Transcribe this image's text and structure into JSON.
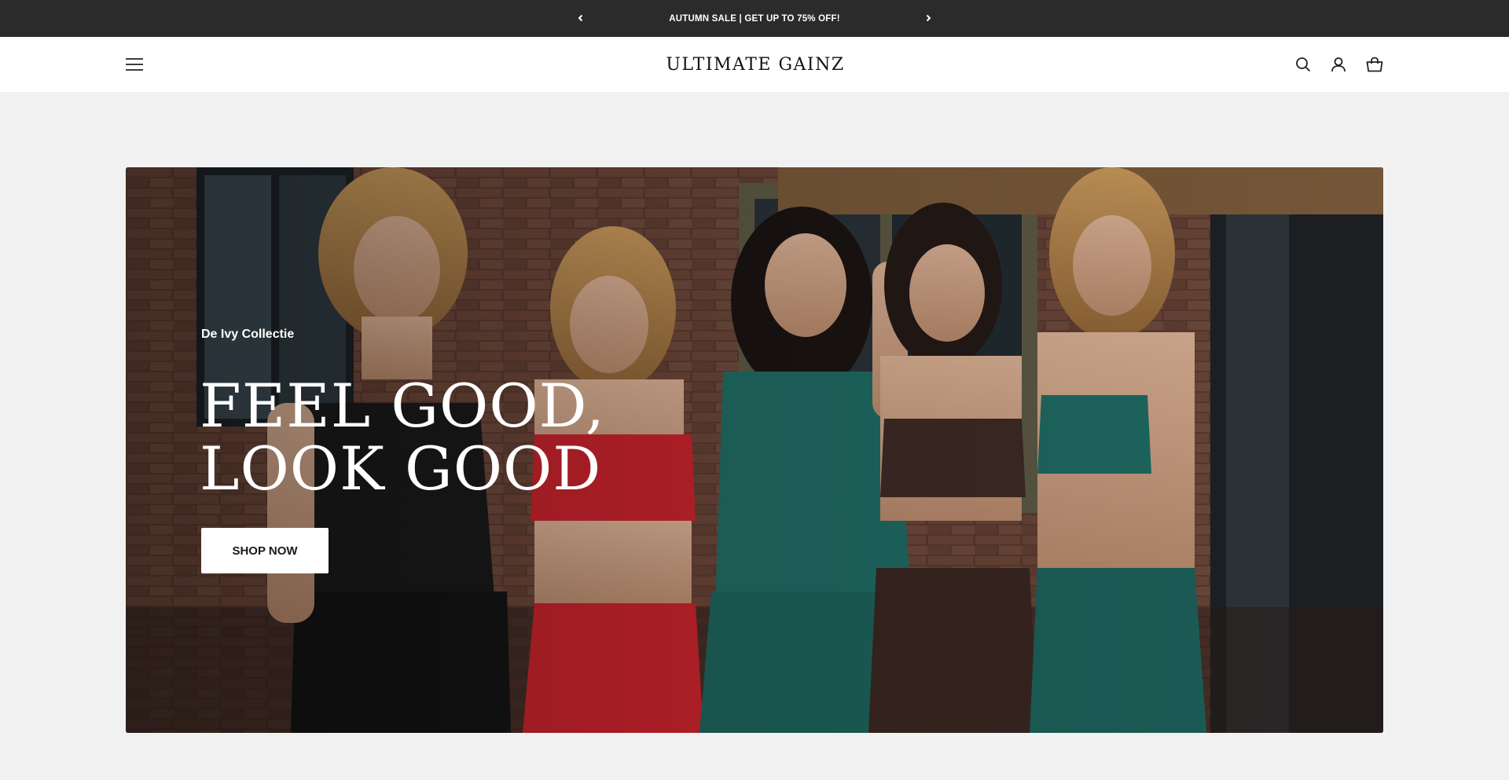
{
  "announcement": {
    "message": "AUTUMN SALE | GET UP TO 75% OFF!",
    "prev_icon": "chevron-left-icon",
    "next_icon": "chevron-right-icon"
  },
  "header": {
    "logo_text": "ULTIMATE GAINZ",
    "menu_icon": "hamburger-menu-icon",
    "search_icon": "search-icon",
    "account_icon": "account-icon",
    "cart_icon": "shopping-bag-icon"
  },
  "hero": {
    "subtitle": "De Ivy Collectie",
    "title_line1": "FEEL GOOD,",
    "title_line2": "LOOK GOOD",
    "cta_label": "SHOP NOW"
  },
  "colors": {
    "announcement_bg": "#2b2b2b",
    "header_bg": "#ffffff",
    "page_bg": "#f1f1f1",
    "accent_teal": "#1f6b63",
    "accent_red": "#c8232c",
    "accent_brown": "#3e2a25"
  }
}
